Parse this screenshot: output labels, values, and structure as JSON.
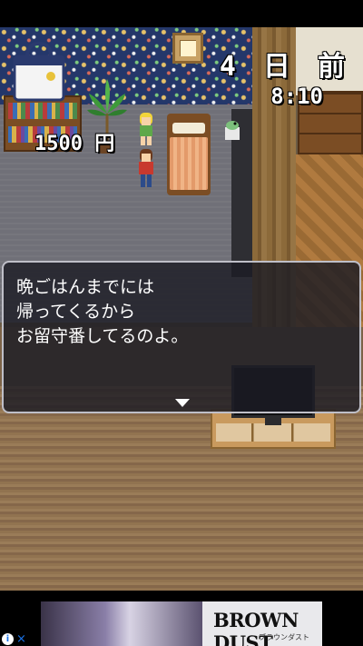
{
  "hud": {
    "day_label": "4 日 前",
    "time_label": "8:10",
    "money_label": "1500 円"
  },
  "dialog": {
    "text": "晩ごはんまでには\n帰ってくるから\nお留守番してるのよ。",
    "advance_icon": "triangle-down-icon"
  },
  "ad": {
    "title": "BROWN DUST",
    "subtitle": "ブラウンダスト",
    "info_icon": "info-icon",
    "close_icon": "close-icon"
  },
  "colors": {
    "wallpaper": "#24376a",
    "carpet": "#707078",
    "wood_floor": "#917350",
    "dialog_bg": "#1c1c24",
    "dialog_border": "#bfbfc8"
  }
}
